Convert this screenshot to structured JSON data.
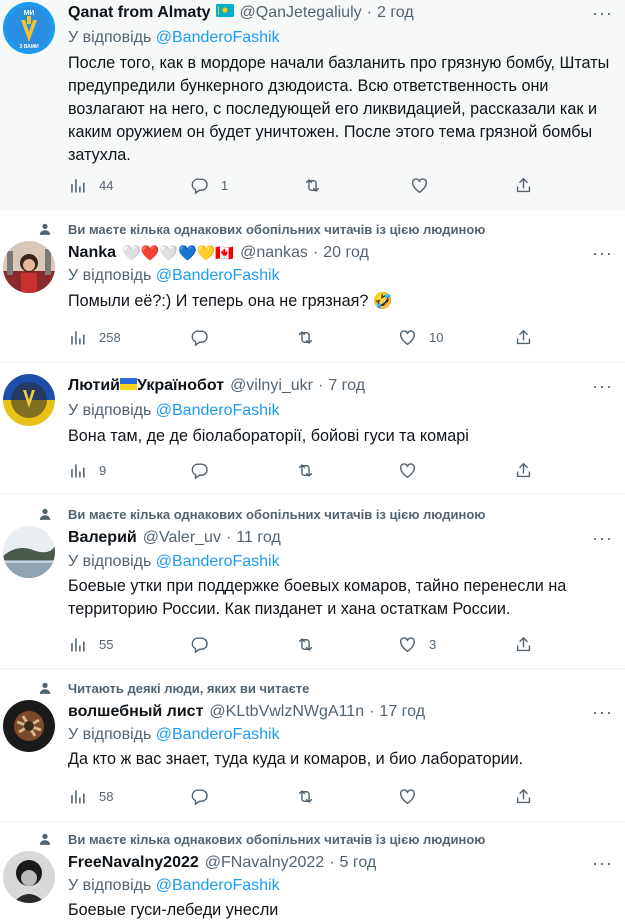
{
  "ui": {
    "reply_prefix": "У відповідь",
    "reply_to": "@BanderoFashik",
    "more": "···",
    "dot": "·"
  },
  "colors": {
    "accent": "#1d9bf0",
    "muted": "#536471",
    "text": "#0f1419",
    "highlight_bg": "#f7f9f9"
  },
  "tweets": [
    {
      "name": "Qanat from Almaty",
      "flag": "kazakhstan-flag-icon",
      "handle": "@QanJetegaliuly",
      "time": "2 год",
      "text": "После того, как в мордоре начали базланить про грязную бомбу, Штаты предупредили бункерного дзюдоиста. Всю ответственность они возлагают на него, с последующей его ликвидацией, рассказали как и каким оружием он будет уничтожен. После этого тема грязной бомбы затухла.",
      "views": "44",
      "replies": "1",
      "retweets": "",
      "likes": "",
      "avatar_text": "МИ",
      "avatar_sub": "З ВАМИ"
    },
    {
      "context": "Ви маєте кілька однакових обопільних читачів із цією людиною",
      "name": "Nanka",
      "name_emoji": "🤍❤️🤍💙💛🇨🇦",
      "handle": "@nankas",
      "time": "20 год",
      "text": "Помыли её?:) И теперь она не грязная? 🤣",
      "views": "258",
      "replies": "",
      "retweets": "",
      "likes": "10"
    },
    {
      "name_a": "Лютий",
      "name_b": "Українобот",
      "flag": "ukraine-flag-icon",
      "handle": "@vilnyi_ukr",
      "time": "7 год",
      "text": "Вона там, де де біолабораторії, бойові  гуси та комарі",
      "views": "9",
      "replies": "",
      "retweets": "",
      "likes": ""
    },
    {
      "context": "Ви маєте кілька однакових обопільних читачів із цією людиною",
      "name": "Валерий",
      "handle": "@Valer_uv",
      "time": "11 год",
      "text": "Боевые утки при поддержке боевых комаров, тайно перенесли на территорию России. Как пизданет и хана остаткам России.",
      "views": "55",
      "replies": "",
      "retweets": "",
      "likes": "3"
    },
    {
      "context": "Читають деякі люди, яких ви читаєте",
      "name": "волшебный лист",
      "handle": "@KLtbVwlzNWgA11n",
      "time": "17 год",
      "text": "Да кто ж вас знает, туда куда и комаров, и био лаборатории.",
      "views": "58",
      "replies": "",
      "retweets": "",
      "likes": ""
    },
    {
      "context": "Ви маєте кілька однакових обопільних читачів із цією людиною",
      "name": "FreeNavalny2022",
      "handle": "@FNavalny2022",
      "time": "5 год",
      "text": "Боевые гуси-лебеди унесли"
    }
  ]
}
